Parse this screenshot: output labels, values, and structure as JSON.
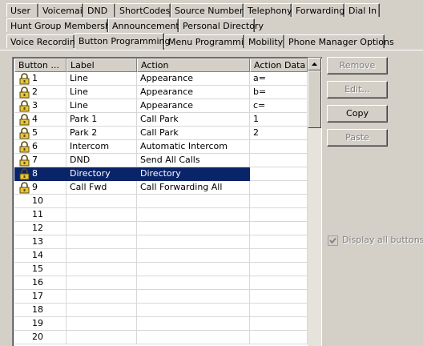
{
  "tabs": {
    "row1": [
      "User",
      "Voicemail",
      "DND",
      "ShortCodes",
      "Source Numbers",
      "Telephony",
      "Forwarding",
      "Dial In"
    ],
    "row2": [
      "Hunt Group Membership",
      "Announcements",
      "Personal Directory"
    ],
    "row3": [
      "Voice Recording",
      "Button Programming",
      "Menu Programming",
      "Mobility",
      "Phone Manager Options"
    ],
    "active": "Button Programming"
  },
  "grid": {
    "columns": [
      "Button ...",
      "Label",
      "Action",
      "Action Data"
    ],
    "rows": [
      {
        "button": "1",
        "label": "Line",
        "action": "Appearance",
        "data": "a=",
        "icon": "lock-icon"
      },
      {
        "button": "2",
        "label": "Line",
        "action": "Appearance",
        "data": "b=",
        "icon": "lock-icon"
      },
      {
        "button": "3",
        "label": "Line",
        "action": "Appearance",
        "data": "c=",
        "icon": "lock-icon"
      },
      {
        "button": "4",
        "label": "Park 1",
        "action": "Call Park",
        "data": "1",
        "icon": "lock-icon"
      },
      {
        "button": "5",
        "label": "Park 2",
        "action": "Call Park",
        "data": "2",
        "icon": "lock-icon"
      },
      {
        "button": "6",
        "label": "Intercom",
        "action": "Automatic Intercom",
        "data": "",
        "icon": "lock-icon"
      },
      {
        "button": "7",
        "label": "DND",
        "action": "Send All Calls",
        "data": "",
        "icon": "lock-icon"
      },
      {
        "button": "8",
        "label": "Directory",
        "action": "Directory",
        "data": "",
        "icon": "lock-icon",
        "selected": true
      },
      {
        "button": "9",
        "label": "Call Fwd",
        "action": "Call Forwarding All",
        "data": "",
        "icon": "lock-icon"
      },
      {
        "button": "10",
        "label": "",
        "action": "",
        "data": ""
      },
      {
        "button": "11",
        "label": "",
        "action": "",
        "data": ""
      },
      {
        "button": "12",
        "label": "",
        "action": "",
        "data": ""
      },
      {
        "button": "13",
        "label": "",
        "action": "",
        "data": ""
      },
      {
        "button": "14",
        "label": "",
        "action": "",
        "data": ""
      },
      {
        "button": "15",
        "label": "",
        "action": "",
        "data": ""
      },
      {
        "button": "16",
        "label": "",
        "action": "",
        "data": ""
      },
      {
        "button": "17",
        "label": "",
        "action": "",
        "data": ""
      },
      {
        "button": "18",
        "label": "",
        "action": "",
        "data": ""
      },
      {
        "button": "19",
        "label": "",
        "action": "",
        "data": ""
      },
      {
        "button": "20",
        "label": "",
        "action": "",
        "data": ""
      }
    ]
  },
  "buttons": {
    "remove": {
      "label": "Remove",
      "enabled": false
    },
    "edit": {
      "label": "Edit...",
      "enabled": false
    },
    "copy": {
      "label": "Copy",
      "enabled": true
    },
    "paste": {
      "label": "Paste",
      "enabled": false
    }
  },
  "display_all": {
    "label": "Display all buttons",
    "checked": true,
    "enabled": false
  },
  "colors": {
    "selection": "#0a246a",
    "face": "#d4d0c8"
  }
}
